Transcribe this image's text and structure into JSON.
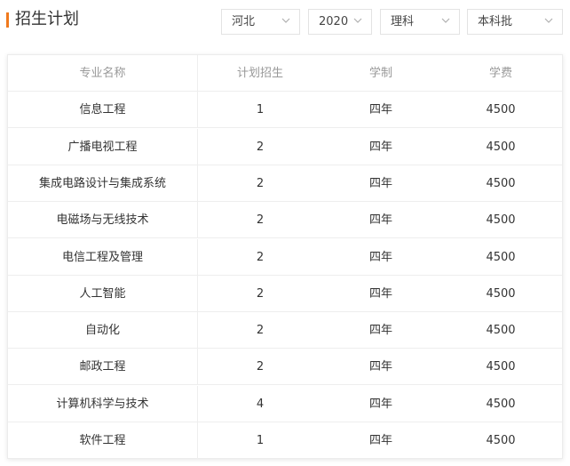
{
  "header": {
    "title": "招生计划"
  },
  "filters": {
    "province": "河北",
    "year": "2020",
    "subject_type": "理科",
    "batch": "本科批"
  },
  "table": {
    "columns": [
      "专业名称",
      "计划招生",
      "学制",
      "学费"
    ],
    "rows": [
      {
        "major": "信息工程",
        "plan": "1",
        "duration": "四年",
        "fee": "4500"
      },
      {
        "major": "广播电视工程",
        "plan": "2",
        "duration": "四年",
        "fee": "4500"
      },
      {
        "major": "集成电路设计与集成系统",
        "plan": "2",
        "duration": "四年",
        "fee": "4500"
      },
      {
        "major": "电磁场与无线技术",
        "plan": "2",
        "duration": "四年",
        "fee": "4500"
      },
      {
        "major": "电信工程及管理",
        "plan": "2",
        "duration": "四年",
        "fee": "4500"
      },
      {
        "major": "人工智能",
        "plan": "2",
        "duration": "四年",
        "fee": "4500"
      },
      {
        "major": "自动化",
        "plan": "2",
        "duration": "四年",
        "fee": "4500"
      },
      {
        "major": "邮政工程",
        "plan": "2",
        "duration": "四年",
        "fee": "4500"
      },
      {
        "major": "计算机科学与技术",
        "plan": "4",
        "duration": "四年",
        "fee": "4500"
      },
      {
        "major": "软件工程",
        "plan": "1",
        "duration": "四年",
        "fee": "4500"
      }
    ]
  },
  "colors": {
    "accent": "#f07a1d",
    "header_text": "#999999",
    "body_text": "#333333",
    "border": "#eeeeee"
  },
  "icons": {
    "dropdown": "chevron-down-icon"
  }
}
